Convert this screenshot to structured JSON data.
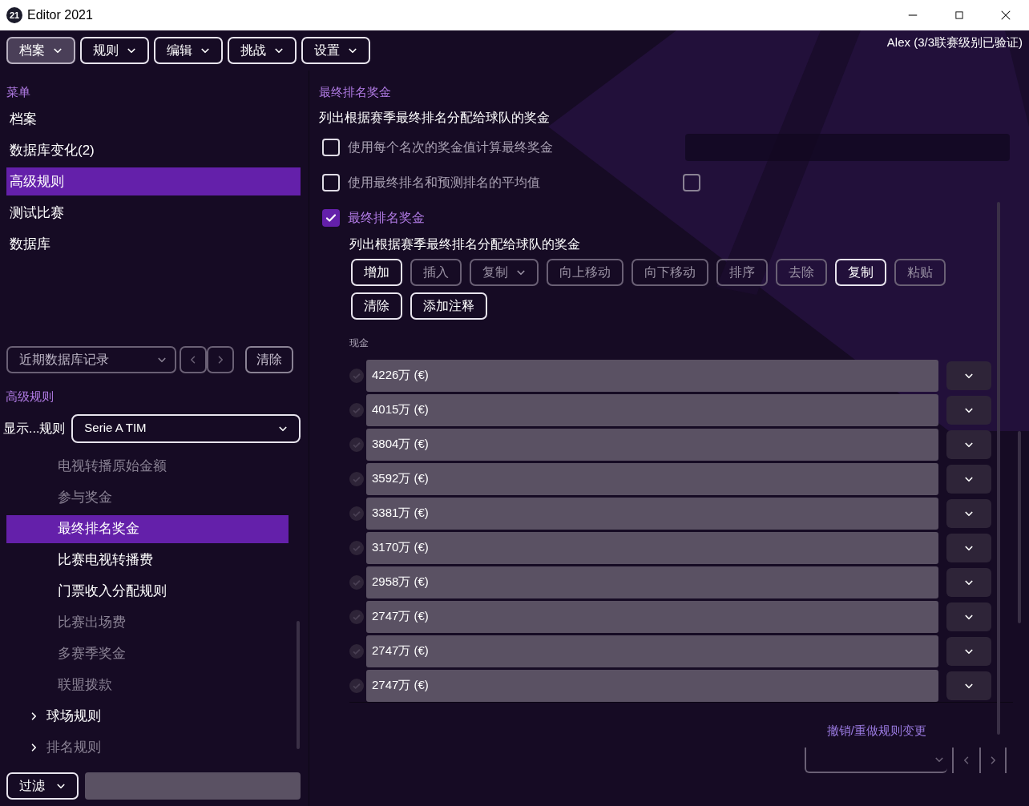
{
  "window": {
    "title": "Editor 2021",
    "logo": "21"
  },
  "menu_bar": {
    "items": [
      {
        "label": "档案",
        "selected": true
      },
      {
        "label": "规则",
        "selected": false
      },
      {
        "label": "编辑",
        "selected": false
      },
      {
        "label": "挑战",
        "selected": false
      },
      {
        "label": "设置",
        "selected": false
      }
    ],
    "user": "Alex (3/3联赛级别已验证)"
  },
  "sidebar": {
    "heading": "菜单",
    "items": [
      {
        "label": "档案",
        "selected": false
      },
      {
        "label": "数据库变化(2)",
        "selected": false
      },
      {
        "label": "高级规则",
        "selected": true
      },
      {
        "label": "测试比赛",
        "selected": false
      },
      {
        "label": "数据库",
        "selected": false
      }
    ]
  },
  "history": {
    "value": "近期数据库记录",
    "clear": "清除"
  },
  "rules": {
    "heading": "高级规则",
    "show_label": "显示...规则",
    "league": "Serie A TIM",
    "items": [
      {
        "label": "电视转播原始金额",
        "selected": false,
        "disabled": true
      },
      {
        "label": "参与奖金",
        "selected": false,
        "disabled": true
      },
      {
        "label": "最终排名奖金",
        "selected": true,
        "disabled": false
      },
      {
        "label": "比赛电视转播费",
        "selected": false,
        "disabled": false
      },
      {
        "label": "门票收入分配规则",
        "selected": false,
        "disabled": false
      },
      {
        "label": "比赛出场费",
        "selected": false,
        "disabled": true
      },
      {
        "label": "多赛季奖金",
        "selected": false,
        "disabled": true
      },
      {
        "label": "联盟拨款",
        "selected": false,
        "disabled": true
      }
    ],
    "groups": [
      {
        "label": "球场规则",
        "expanded": false,
        "disabled": false
      },
      {
        "label": "排名规则",
        "expanded": false,
        "disabled": true
      }
    ],
    "filter": "过滤"
  },
  "content": {
    "heading": "最终排名奖金",
    "description": "列出根据赛季最终排名分配给球队的奖金",
    "options": [
      {
        "label": "使用每个名次的奖金值计算最终奖金",
        "checked": false,
        "kind": "field"
      },
      {
        "label": "使用最终排名和预测排名的平均值",
        "checked": false,
        "kind": "checkbox"
      },
      {
        "label": "最终排名奖金",
        "checked": true,
        "kind": "plain"
      }
    ],
    "extra_checkbox": {
      "checked": false
    },
    "sub_description": "列出根据赛季最终排名分配给球队的奖金",
    "toolbar": [
      {
        "label": "增加",
        "disabled": false,
        "kind": "button"
      },
      {
        "label": "插入",
        "disabled": true,
        "kind": "button"
      },
      {
        "label": "复制",
        "disabled": true,
        "kind": "dropdown"
      },
      {
        "label": "向上移动",
        "disabled": true,
        "kind": "button"
      },
      {
        "label": "向下移动",
        "disabled": true,
        "kind": "button"
      },
      {
        "label": "排序",
        "disabled": true,
        "kind": "button"
      },
      {
        "label": "去除",
        "disabled": true,
        "kind": "button"
      },
      {
        "label": "复制",
        "disabled": false,
        "kind": "button"
      },
      {
        "label": "粘贴",
        "disabled": true,
        "kind": "button"
      },
      {
        "label": "清除",
        "disabled": false,
        "kind": "button"
      },
      {
        "label": "添加注释",
        "disabled": false,
        "kind": "button"
      }
    ],
    "column": "现金",
    "rows": [
      {
        "value": "4226万 (€)"
      },
      {
        "value": "4015万 (€)"
      },
      {
        "value": "3804万 (€)"
      },
      {
        "value": "3592万 (€)"
      },
      {
        "value": "3381万 (€)"
      },
      {
        "value": "3170万 (€)"
      },
      {
        "value": "2958万 (€)"
      },
      {
        "value": "2747万 (€)"
      },
      {
        "value": "2747万 (€)"
      },
      {
        "value": "2747万 (€)"
      }
    ],
    "undo_label": "撤销/重做规则变更"
  }
}
